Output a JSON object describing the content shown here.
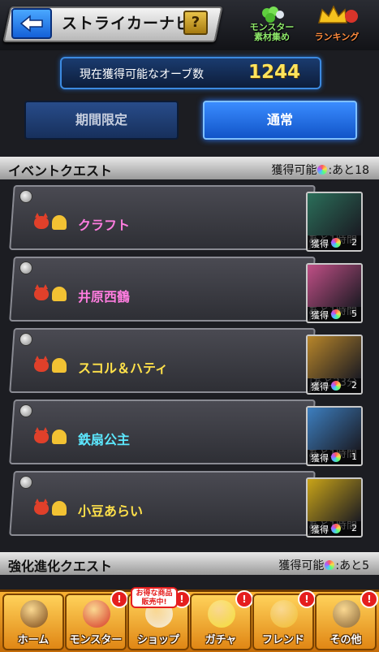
{
  "header": {
    "title": "ストライカーナビ",
    "help_label": "?",
    "material_button_label": "モンスター\n素材集め",
    "ranking_button_label": "ランキング"
  },
  "orb_bar": {
    "label": "現在獲得可能なオーブ数",
    "count": "1244"
  },
  "tabs": [
    {
      "label": "期間限定",
      "selected": false
    },
    {
      "label": "通常",
      "selected": true
    }
  ],
  "event_section": {
    "title": "イベントクエスト",
    "available_label": "獲得可能",
    "remaining": ":あと18"
  },
  "quests": [
    {
      "name": "クラフト",
      "name_color": "#ff7de0",
      "time": "あと1時間",
      "reward_label": "獲得",
      "reward_count": "2",
      "art_color": "#2b6f5a"
    },
    {
      "name": "井原西鶴",
      "name_color": "#ff7de0",
      "time": "あと1時間",
      "reward_label": "獲得",
      "reward_count": "5",
      "art_color": "#c04f86"
    },
    {
      "name": "スコル＆ハティ",
      "name_color": "#ffe14a",
      "time": "あと23分",
      "reward_label": "獲得",
      "reward_count": "2",
      "art_color": "#b8862a"
    },
    {
      "name": "鉄扇公主",
      "name_color": "#5ce8ff",
      "time": "あと1時間",
      "reward_label": "獲得",
      "reward_count": "1",
      "art_color": "#3d7fc0"
    },
    {
      "name": "小豆あらい",
      "name_color": "#ffe14a",
      "time": "あと1時間",
      "reward_label": "獲得",
      "reward_count": "2",
      "art_color": "#c9a418"
    }
  ],
  "evolution_section": {
    "title": "強化進化クエスト",
    "available_label": "獲得可能",
    "remaining": ":あと5"
  },
  "footer": {
    "items": [
      {
        "label": "ホーム",
        "icon": "home-icon",
        "badge": ""
      },
      {
        "label": "モンスター",
        "icon": "monster-icon",
        "badge": "!"
      },
      {
        "label": "ショップ",
        "icon": "shop-icon",
        "badge": "!",
        "tag": "お得な商品\n販売中!"
      },
      {
        "label": "ガチャ",
        "icon": "gacha-icon",
        "badge": "!"
      },
      {
        "label": "フレンド",
        "icon": "friend-icon",
        "badge": "!"
      },
      {
        "label": "その他",
        "icon": "other-icon",
        "badge": "!"
      }
    ]
  }
}
